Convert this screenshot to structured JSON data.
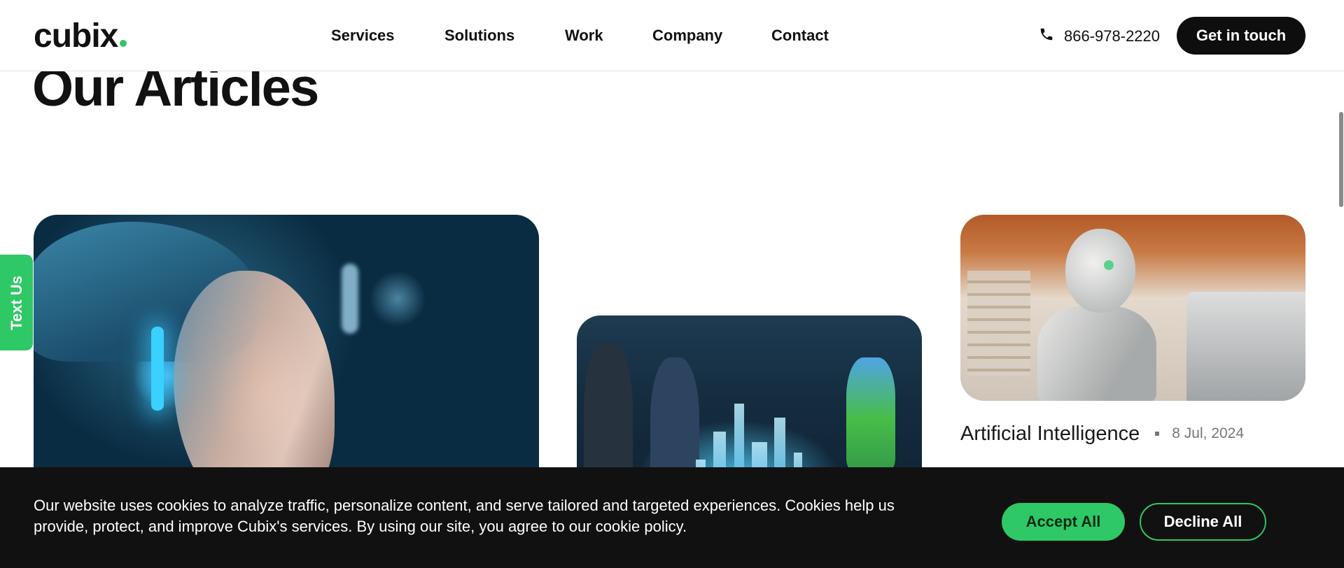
{
  "header": {
    "logo": "cubix",
    "nav": [
      {
        "label": "Services"
      },
      {
        "label": "Solutions"
      },
      {
        "label": "Work"
      },
      {
        "label": "Company"
      },
      {
        "label": "Contact"
      }
    ],
    "phone": "866-978-2220",
    "cta_label": "Get in touch"
  },
  "main": {
    "title": "Our Articles",
    "articles": [
      {
        "image": "ai-woman-cyborg-image"
      },
      {
        "image": "hologram-city-meeting-image"
      },
      {
        "image": "robot-store-image",
        "category": "Artificial Intelligence",
        "date": "8 Jul, 2024"
      }
    ]
  },
  "side_tab": {
    "label": "Text Us"
  },
  "cookie_banner": {
    "text": "Our website uses cookies to analyze traffic, personalize content, and serve tailored and targeted experiences. Cookies help us provide, protect, and improve Cubix's services. By using our site, you agree to our cookie policy.",
    "accept_label": "Accept All",
    "decline_label": "Decline All"
  },
  "colors": {
    "accent": "#2ec866",
    "dark": "#111111"
  }
}
